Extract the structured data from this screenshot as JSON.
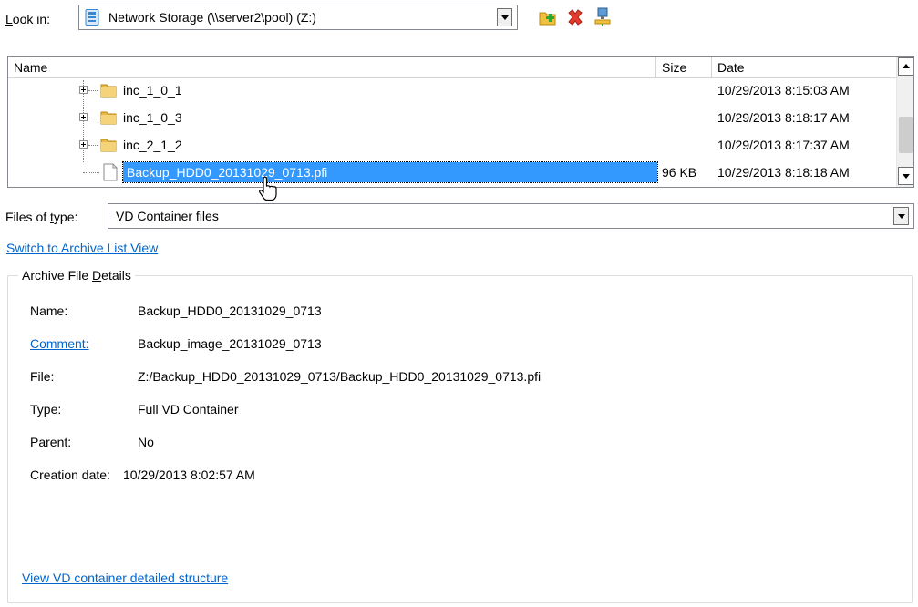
{
  "look_in": {
    "label_prefix": "",
    "label_accel": "L",
    "label_rest": "ook in:",
    "value": "Network Storage (\\\\server2\\pool) (Z:)"
  },
  "toolbar": {
    "icons": [
      "new-folder-icon",
      "delete-icon",
      "network-drive-icon"
    ]
  },
  "file_list": {
    "columns": [
      "Name",
      "Size",
      "Date"
    ],
    "rows": [
      {
        "name": "inc_1_0_1",
        "size": "",
        "date": "10/29/2013 8:15:03 AM",
        "type": "folder"
      },
      {
        "name": "inc_1_0_3",
        "size": "",
        "date": "10/29/2013 8:18:17 AM",
        "type": "folder"
      },
      {
        "name": "inc_2_1_2",
        "size": "",
        "date": "10/29/2013 8:17:37 AM",
        "type": "folder"
      },
      {
        "name": "Backup_HDD0_20131029_0713.pfi",
        "size": "96 KB",
        "date": "10/29/2013 8:18:18 AM",
        "type": "file",
        "selected": true
      }
    ]
  },
  "files_of_type": {
    "label_pre": "Files of ",
    "label_accel": "t",
    "label_post": "ype:",
    "value": "VD Container files"
  },
  "switch_link": "Switch to Archive List View",
  "details": {
    "legend_pre": "Archive File ",
    "legend_accel": "D",
    "legend_post": "etails",
    "fields": [
      {
        "label": "Name:",
        "value": "Backup_HDD0_20131029_0713"
      },
      {
        "label": "Comment:",
        "value": "Backup_image_20131029_0713"
      },
      {
        "label": "File:",
        "value": "Z:/Backup_HDD0_20131029_0713/Backup_HDD0_20131029_0713.pfi"
      },
      {
        "label": "Type:",
        "value": "Full VD Container"
      },
      {
        "label": "Parent:",
        "value": "No"
      },
      {
        "label": "Creation date:",
        "value": "10/29/2013 8:02:57 AM"
      }
    ],
    "structure_link": "View VD container detailed structure"
  },
  "colors": {
    "selection": "#3399ff",
    "link": "#0066cc",
    "folder": "#e8b84a"
  }
}
